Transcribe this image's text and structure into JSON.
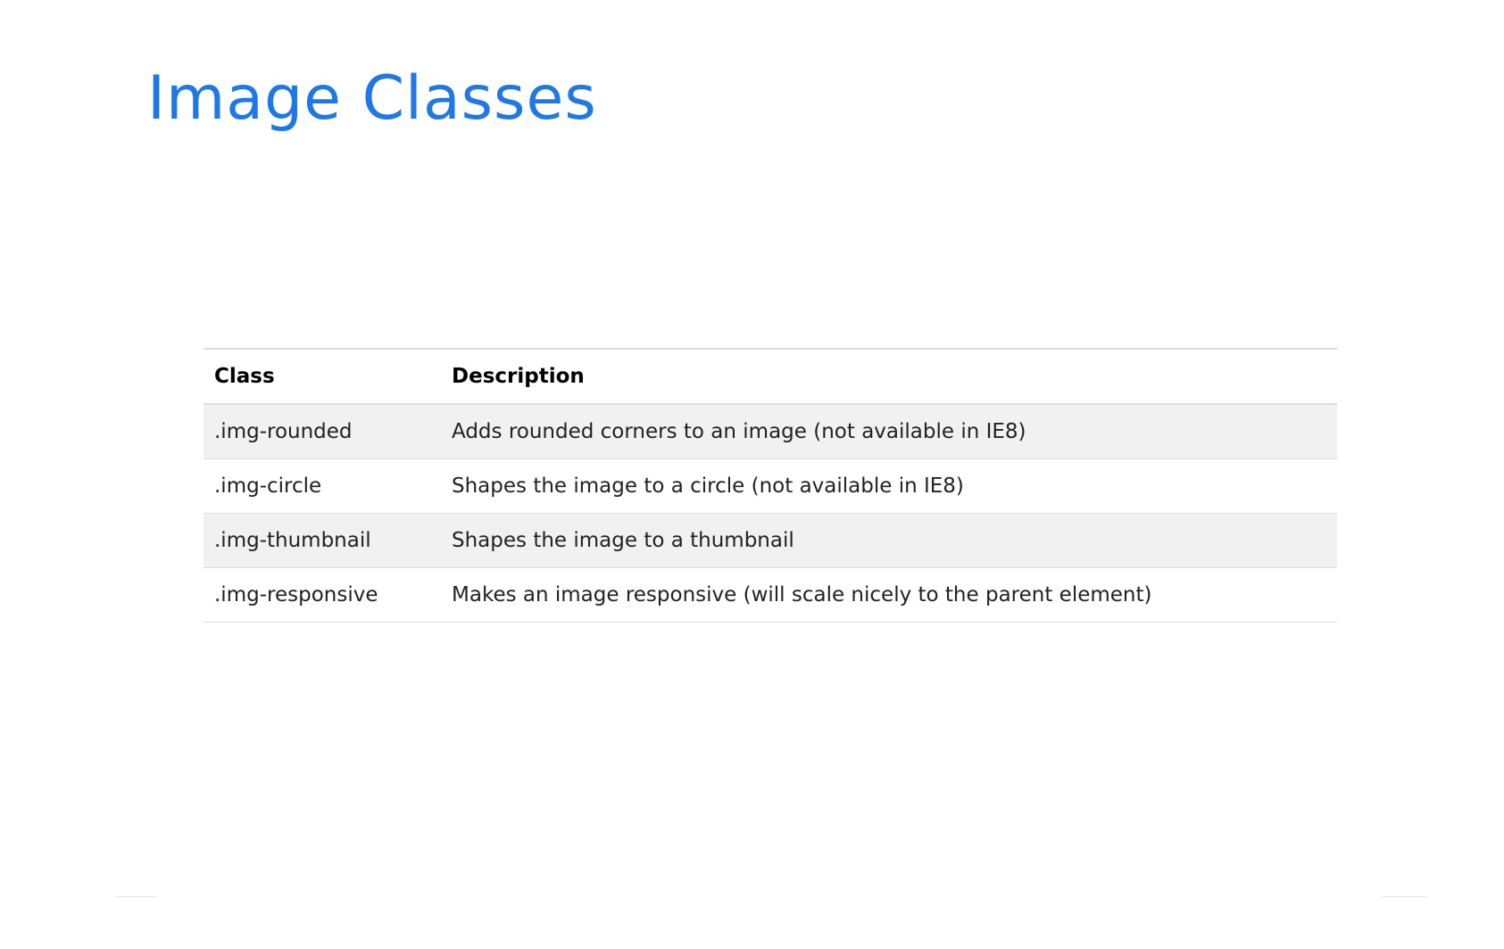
{
  "slide": {
    "title": "Image Classes"
  },
  "table": {
    "headers": {
      "class": "Class",
      "description": "Description"
    },
    "rows": [
      {
        "class": ".img-rounded",
        "description": "Adds rounded corners to an image (not available in IE8)"
      },
      {
        "class": ".img-circle",
        "description": "Shapes the image to a circle (not available in IE8)"
      },
      {
        "class": ".img-thumbnail",
        "description": "Shapes the image to a thumbnail"
      },
      {
        "class": ".img-responsive",
        "description": "Makes an image responsive (will scale nicely to the parent element)"
      }
    ]
  },
  "colors": {
    "title": "#1f78e6",
    "stripe": "#f1f1f1",
    "border": "#dddddd"
  }
}
